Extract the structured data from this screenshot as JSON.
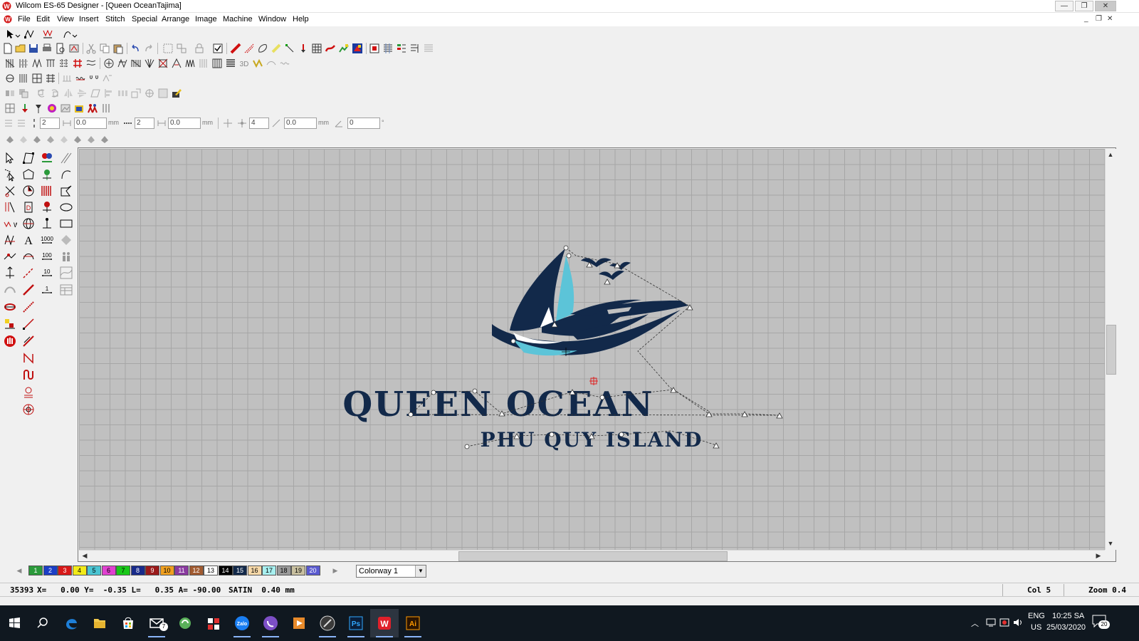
{
  "window": {
    "title": "Wilcom ES-65 Designer - [Queen Ocean",
    "machine": "Tajima]",
    "minimize": "—",
    "restore": "❐",
    "close": "✕"
  },
  "menu": {
    "items": [
      "File",
      "Edit",
      "View",
      "Insert",
      "Stitch",
      "Special",
      "Arrange",
      "Image",
      "Machine",
      "Window",
      "Help"
    ],
    "mdi_min": "_",
    "mdi_restore": "❐",
    "mdi_close": "✕"
  },
  "toolbar": {
    "spin_values": [
      "2",
      "0.0",
      "2",
      "0.0",
      "4",
      "0.0",
      "0"
    ],
    "unit_mm": "mm",
    "unit_deg": "°"
  },
  "design": {
    "title": "QUEEN  OCEAN",
    "subtitle": "PHU QUY   ISLAND",
    "colors": {
      "navy": "#12294a",
      "cyan": "#5cc4d8"
    }
  },
  "palette": {
    "swatches": [
      {
        "num": "1",
        "color": "#2a9a3a"
      },
      {
        "num": "2",
        "color": "#1c3fc6"
      },
      {
        "num": "3",
        "color": "#d81818"
      },
      {
        "num": "4",
        "color": "#f2ea18"
      },
      {
        "num": "5",
        "color": "#4ac4d2"
      },
      {
        "num": "6",
        "color": "#e040d0"
      },
      {
        "num": "7",
        "color": "#18c818"
      },
      {
        "num": "8",
        "color": "#182a8a"
      },
      {
        "num": "9",
        "color": "#9a1a1a"
      },
      {
        "num": "10",
        "color": "#f0a020"
      },
      {
        "num": "11",
        "color": "#8a3aa0"
      },
      {
        "num": "12",
        "color": "#a05a30"
      },
      {
        "num": "13",
        "color": "#ffffff"
      },
      {
        "num": "14",
        "color": "#000000"
      },
      {
        "num": "15",
        "color": "#12294a"
      },
      {
        "num": "16",
        "color": "#f6d8a8"
      },
      {
        "num": "17",
        "color": "#a8f0f0"
      },
      {
        "num": "18",
        "color": "#9a9a9a"
      },
      {
        "num": "19",
        "color": "#c8c0a0"
      },
      {
        "num": "20",
        "color": "#5a5ad0"
      }
    ],
    "colorway": "Colorway 1"
  },
  "status": {
    "stitches": "35393",
    "coords": "X=   0.00 Y=  -0.35 L=   0.35 A= -90.00",
    "stitch_type": "SATIN  0.40 mm",
    "col": "Col 5",
    "zoom": "Zoom 0.4"
  },
  "taskbar": {
    "apps": [
      "start",
      "search",
      "edge",
      "file-explorer",
      "store",
      "mail",
      "app-green",
      "app-grid",
      "zalo",
      "viber",
      "video",
      "app-dark",
      "photoshop",
      "wilcom",
      "illustrator"
    ],
    "badge_mail": "7",
    "lang": "ENG",
    "region": "US",
    "time": "10:25 SA",
    "date": "25/03/2020",
    "notifications": "20"
  }
}
